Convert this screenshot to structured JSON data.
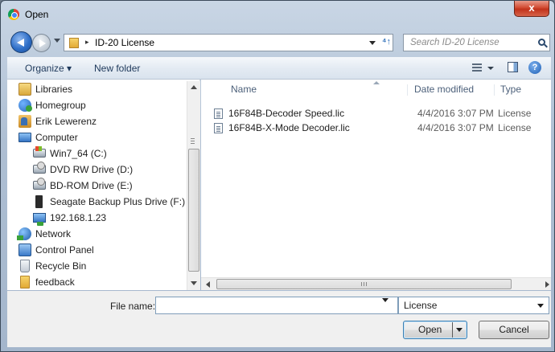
{
  "window": {
    "title": "Open",
    "close_glyph": "x"
  },
  "address": {
    "path": "ID-20 License",
    "separator": "▸",
    "refresh_glyph": "⁴↑"
  },
  "search": {
    "placeholder": "Search ID-20 License"
  },
  "toolbar": {
    "organize": "Organize ▾",
    "new_folder": "New folder",
    "help": "?"
  },
  "nav": {
    "items": [
      {
        "label": "Libraries",
        "icon": "libraries-icon"
      },
      {
        "label": "Homegroup",
        "icon": "homegroup-icon"
      },
      {
        "label": "Erik Lewerenz",
        "icon": "user-folder-icon"
      },
      {
        "label": "Computer",
        "icon": "computer-icon"
      },
      {
        "label": "Win7_64 (C:)",
        "icon": "windows-drive-icon"
      },
      {
        "label": "DVD RW Drive (D:)",
        "icon": "optical-drive-icon"
      },
      {
        "label": "BD-ROM Drive (E:)",
        "icon": "optical-drive-icon"
      },
      {
        "label": "Seagate Backup Plus Drive (F:)",
        "icon": "external-drive-icon"
      },
      {
        "label": "192.168.1.23",
        "icon": "network-computer-icon"
      },
      {
        "label": "Network",
        "icon": "network-icon"
      },
      {
        "label": "Control Panel",
        "icon": "control-panel-icon"
      },
      {
        "label": "Recycle Bin",
        "icon": "recycle-bin-icon"
      },
      {
        "label": "feedback",
        "icon": "folder-icon"
      }
    ]
  },
  "files": {
    "columns": {
      "name": "Name",
      "date": "Date modified",
      "type": "Type"
    },
    "rows": [
      {
        "name": "16F84B-Decoder Speed.lic",
        "date": "4/4/2016 3:07 PM",
        "type": "License"
      },
      {
        "name": "16F84B-X-Mode Decoder.lic",
        "date": "4/4/2016 3:07 PM",
        "type": "License"
      }
    ]
  },
  "bottom": {
    "file_name_label": "File name:",
    "file_name_value": "",
    "file_type": "License",
    "open_label": "Open",
    "cancel_label": "Cancel"
  }
}
